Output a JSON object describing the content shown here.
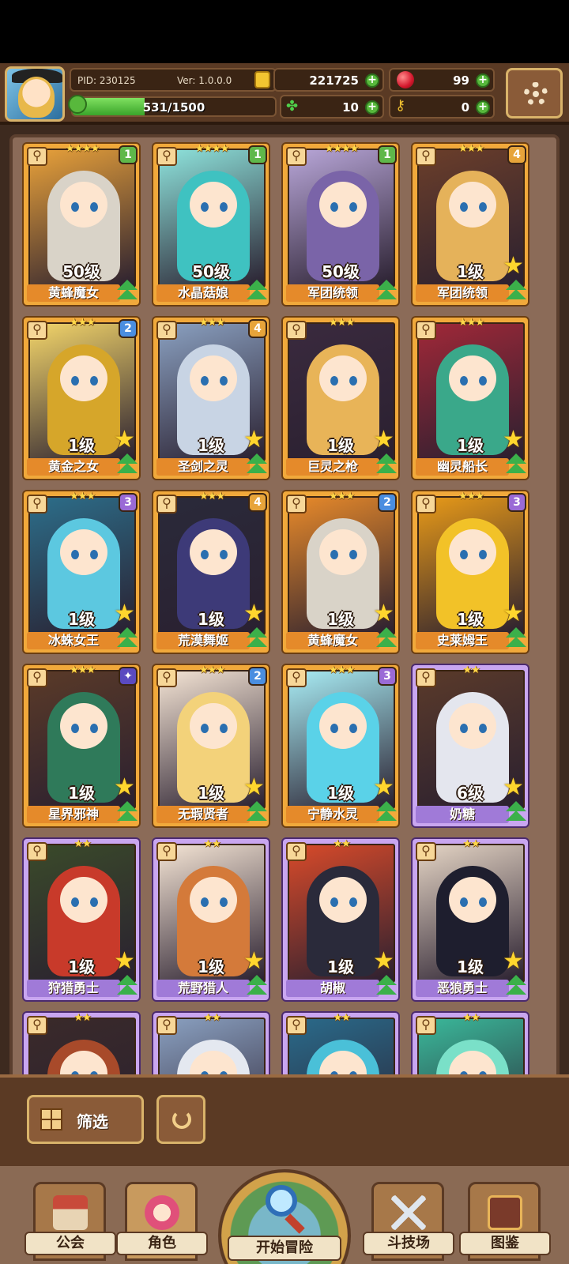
{
  "header": {
    "pid": "PID: 230125",
    "version": "Ver: 1.0.0.0",
    "gold": "221725",
    "gems": "99",
    "clover": "10",
    "keys": "0",
    "exp_text": "531/1500",
    "exp_fraction": 0.354
  },
  "cards": [
    {
      "name": "黄蜂魔女",
      "level": "50级",
      "stars": "★★★★",
      "badge": "1",
      "badge_color": "#5fb84a",
      "frame": "gold",
      "palette": [
        "#d9d3c8",
        "#e8a13a"
      ],
      "show_star": false
    },
    {
      "name": "水晶菇娘",
      "level": "50级",
      "stars": "★★★★",
      "badge": "1",
      "badge_color": "#5fb84a",
      "frame": "gold",
      "palette": [
        "#3fc2c1",
        "#8ee3dc"
      ],
      "show_star": false
    },
    {
      "name": "军团统领",
      "level": "50级",
      "stars": "★★★★",
      "badge": "1",
      "badge_color": "#5fb84a",
      "frame": "gold",
      "palette": [
        "#7a64a8",
        "#b8a6d8"
      ],
      "show_star": false
    },
    {
      "name": "军团统领",
      "level": "1级",
      "stars": "★★★",
      "badge": "4",
      "badge_color": "#e7a43a",
      "frame": "gold",
      "palette": [
        "#e5b25a",
        "#6b3e2a"
      ],
      "show_star": true
    },
    {
      "name": "黄金之女",
      "level": "1级",
      "stars": "★★★",
      "badge": "2",
      "badge_color": "#4a8ee0",
      "frame": "gold",
      "palette": [
        "#d6a62a",
        "#f3d56a"
      ],
      "show_star": true
    },
    {
      "name": "圣剑之灵",
      "level": "1级",
      "stars": "★★★",
      "badge": "4",
      "badge_color": "#e7a43a",
      "frame": "gold",
      "palette": [
        "#c8d4e4",
        "#8aa0c0"
      ],
      "show_star": true
    },
    {
      "name": "巨灵之枪",
      "level": "1级",
      "stars": "★★★",
      "badge": "",
      "badge_color": "",
      "frame": "gold",
      "palette": [
        "#e8b458",
        "#3a2a3e"
      ],
      "show_star": true
    },
    {
      "name": "幽灵船长",
      "level": "1级",
      "stars": "★★★",
      "badge": "",
      "badge_color": "",
      "frame": "gold",
      "palette": [
        "#3aa88a",
        "#a02838"
      ],
      "show_star": true
    },
    {
      "name": "冰蛛女王",
      "level": "1级",
      "stars": "★★★",
      "badge": "3",
      "badge_color": "#9a6ad6",
      "frame": "gold",
      "palette": [
        "#5cc8e0",
        "#2c6e8a"
      ],
      "show_star": true
    },
    {
      "name": "荒漠舞姬",
      "level": "1级",
      "stars": "★★★",
      "badge": "4",
      "badge_color": "#e7a43a",
      "frame": "gold",
      "palette": [
        "#3d3a78",
        "#2a2a3a"
      ],
      "show_star": true
    },
    {
      "name": "黄蜂魔女",
      "level": "1级",
      "stars": "★★★",
      "badge": "2",
      "badge_color": "#4a8ee0",
      "frame": "gold",
      "palette": [
        "#d9d3c8",
        "#e88a2a"
      ],
      "show_star": true
    },
    {
      "name": "史莱姆王",
      "level": "1级",
      "stars": "★★★",
      "badge": "3",
      "badge_color": "#9a6ad6",
      "frame": "gold",
      "palette": [
        "#f2c228",
        "#e89a18"
      ],
      "show_star": true
    },
    {
      "name": "星界邪神",
      "level": "1级",
      "stars": "★★★",
      "badge": "✦",
      "badge_color": "#5a4ac0",
      "frame": "gold",
      "palette": [
        "#2f7a5a",
        "#5a3a28"
      ],
      "show_star": true
    },
    {
      "name": "无瑕贤者",
      "level": "1级",
      "stars": "★★★",
      "badge": "2",
      "badge_color": "#4a8ee0",
      "frame": "gold",
      "palette": [
        "#f3d27a",
        "#f4e4d4"
      ],
      "show_star": true
    },
    {
      "name": "宁静水灵",
      "level": "1级",
      "stars": "★★★",
      "badge": "3",
      "badge_color": "#9a6ad6",
      "frame": "gold",
      "palette": [
        "#5ad2e8",
        "#a8ecf4"
      ],
      "show_star": true
    },
    {
      "name": "奶糖",
      "level": "6级",
      "stars": "★★",
      "badge": "",
      "badge_color": "",
      "frame": "purple",
      "palette": [
        "#e4e6ee",
        "#5a3a2a"
      ],
      "show_star": true
    },
    {
      "name": "狩猎勇士",
      "level": "1级",
      "stars": "★★",
      "badge": "",
      "badge_color": "",
      "frame": "purple",
      "palette": [
        "#c83a2a",
        "#3a4a2a"
      ],
      "show_star": true
    },
    {
      "name": "荒野猎人",
      "level": "1级",
      "stars": "★★",
      "badge": "",
      "badge_color": "",
      "frame": "purple",
      "palette": [
        "#d47a3a",
        "#f4e4d4"
      ],
      "show_star": true
    },
    {
      "name": "胡椒",
      "level": "1级",
      "stars": "★★",
      "badge": "",
      "badge_color": "",
      "frame": "purple",
      "palette": [
        "#2a2a3a",
        "#d84a2a"
      ],
      "show_star": true
    },
    {
      "name": "恶狼勇士",
      "level": "1级",
      "stars": "★★",
      "badge": "",
      "badge_color": "",
      "frame": "purple",
      "palette": [
        "#1e1e2e",
        "#e4d4c4"
      ],
      "show_star": true
    },
    {
      "name": "",
      "level": "",
      "stars": "★★",
      "badge": "",
      "badge_color": "",
      "frame": "purple",
      "palette": [
        "#a84a2a",
        "#3a2a2a"
      ],
      "show_star": false
    },
    {
      "name": "",
      "level": "",
      "stars": "★★",
      "badge": "",
      "badge_color": "",
      "frame": "purple",
      "palette": [
        "#e4e8f0",
        "#8aa0c0"
      ],
      "show_star": false
    },
    {
      "name": "",
      "level": "",
      "stars": "★★",
      "badge": "",
      "badge_color": "",
      "frame": "purple",
      "palette": [
        "#4ac0d8",
        "#2a6a8a"
      ],
      "show_star": false
    },
    {
      "name": "",
      "level": "",
      "stars": "★★",
      "badge": "",
      "badge_color": "",
      "frame": "purple",
      "palette": [
        "#7ae0c8",
        "#3ab89a"
      ],
      "show_star": false
    }
  ],
  "filter": {
    "label": "筛选"
  },
  "nav": {
    "guild": "公会",
    "character": "角色",
    "adventure": "开始冒险",
    "arena": "斗技场",
    "codex": "图鉴"
  },
  "icons": {
    "gold": "coin-icon",
    "gem": "gem-icon",
    "clover": "clover-icon",
    "key": "key-icon",
    "settings": "gear-icon",
    "weapon": "wand-icon",
    "filter": "grid-icon",
    "reset": "refresh-icon"
  },
  "colors": {
    "plus": "#58b83c",
    "gold_frame": "#f1a93b",
    "purple_frame": "#c9a6f0",
    "panel": "#3a2414"
  }
}
